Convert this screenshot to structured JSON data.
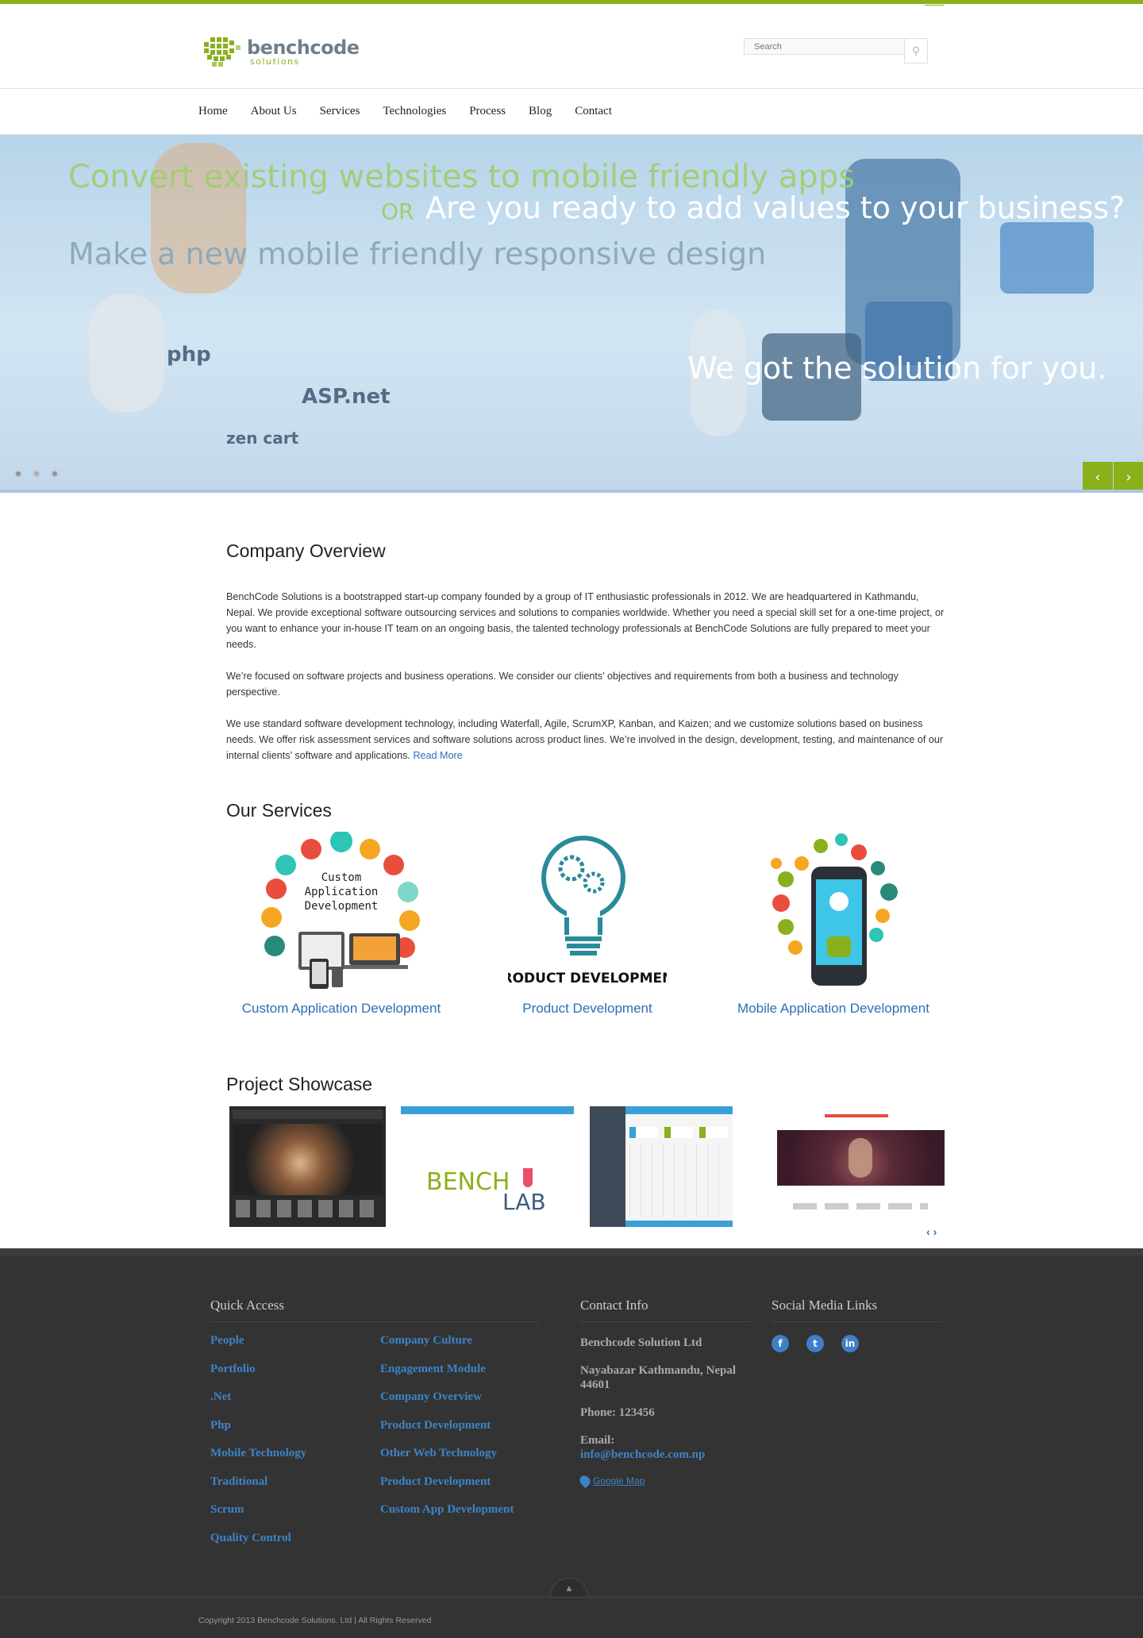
{
  "header": {
    "logo_name": "benchcode",
    "logo_sub": "solutions",
    "search_placeholder": "Search"
  },
  "nav": [
    "Home",
    "About Us",
    "Services",
    "Technologies",
    "Process",
    "Blog",
    "Contact"
  ],
  "hero": {
    "line1": "Convert existing websites to mobile friendly apps",
    "line2": "OR",
    "line3": "Are you ready to add values to your business?",
    "line4": "Make a new mobile friendly responsive design",
    "line5": "We got the solution for you.",
    "logos": [
      "php",
      "ASP.net",
      "zen cart"
    ],
    "slide_count": 3,
    "active_slide": 2
  },
  "overview": {
    "title": "Company Overview",
    "p1": "BenchCode Solutions is a bootstrapped start-up company founded by a group of IT enthusiastic professionals in 2012. We are headquartered in Kathmandu, Nepal. We provide exceptional software outsourcing services and solutions to companies worldwide. Whether you need a special skill set for a one-time project, or you want to enhance your in-house IT team on an ongoing basis, the talented technology professionals at BenchCode Solutions are fully prepared to meet your needs.",
    "p2": "We’re focused on software projects and business operations. We consider our clients’ objectives and requirements from both a business and technology perspective.",
    "p3": "We use standard software development technology, including Waterfall, Agile, ScrumXP, Kanban, and Kaizen; and we customize solutions based on business needs. We offer risk assessment services and software solutions across product lines. We’re involved in the design, development, testing, and maintenance of our internal clients’ software and applications.",
    "read_more": "Read More"
  },
  "services": {
    "title": "Our Services",
    "items": [
      {
        "title": "Custom Application Development",
        "art_text": "Custom Application Development"
      },
      {
        "title": "Product Development",
        "art_text": "PRODUCT DEVELOPMENT"
      },
      {
        "title": "Mobile Application Development"
      }
    ]
  },
  "showcase": {
    "title": "Project Showcase",
    "benchlab_top": "BENCH",
    "benchlab_bottom": "LAB"
  },
  "footer": {
    "quick_access_title": "Quick Access",
    "quick_links_left": [
      "People",
      "Portfolio",
      ".Net",
      "Php",
      "Mobile Technology",
      "Traditional",
      "Scrum",
      "Quality Control"
    ],
    "quick_links_right": [
      "Company Culture",
      "Engagement Module",
      "Company Overview",
      "Product Development",
      "Other Web Technology",
      "Product Development",
      "Custom App Development"
    ],
    "contact_title": "Contact Info",
    "company": "Benchcode Solution Ltd",
    "address": "Nayabazar Kathmandu, Nepal 44601",
    "phone": "Phone: 123456",
    "email_label": "Email:",
    "email": "info@benchcode.com.np",
    "map_label": "Google Map",
    "social_title": "Social Media Links",
    "copyright": "Copyright 2013 Benchcode Solutions. Ltd | All Rights Reserved"
  },
  "colors": {
    "brand_green": "#8ab01c",
    "link_blue": "#2a6fb7",
    "footer_bg": "#333333"
  }
}
